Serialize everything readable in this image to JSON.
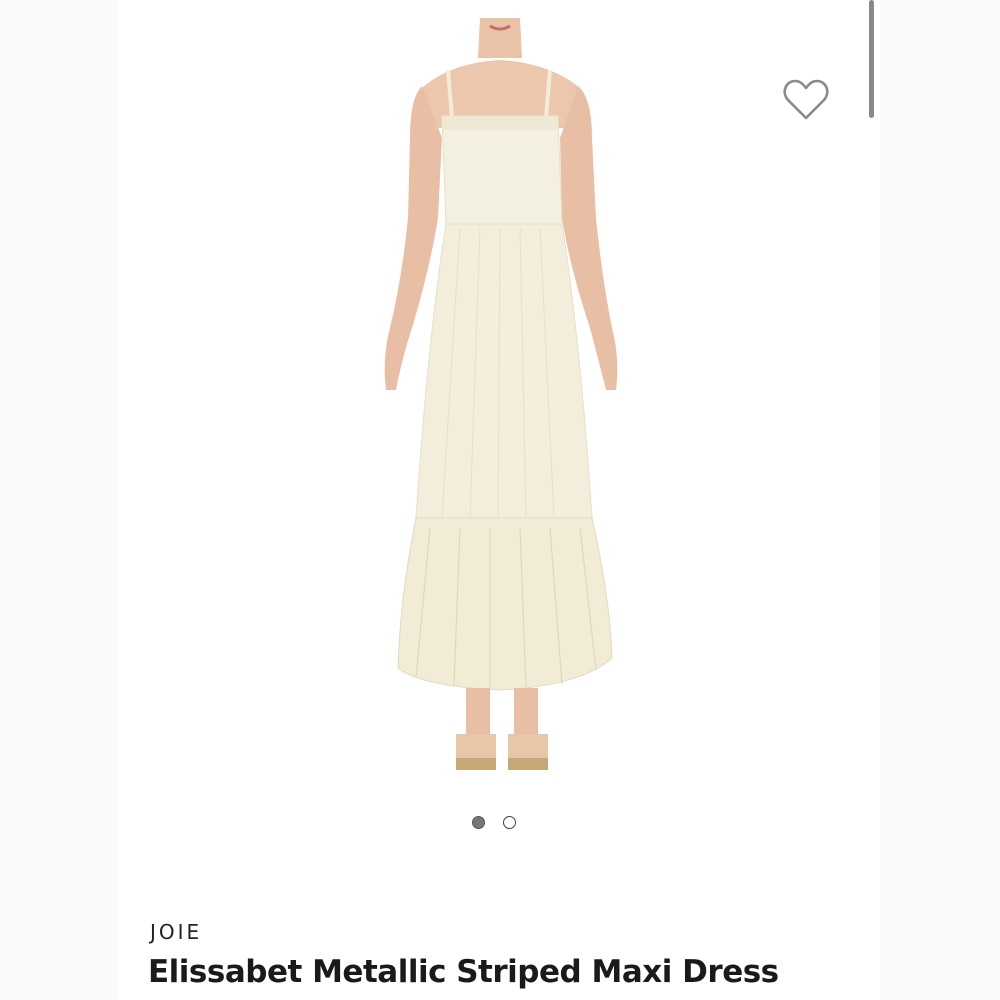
{
  "product": {
    "brand": "JOIE",
    "title": "Elissabet Metallic Striped Maxi Dress",
    "image_alt": "model wearing cream maxi dress"
  },
  "gallery": {
    "total": 2,
    "active_index": 0
  },
  "icons": {
    "wishlist": "heart-outline-icon"
  },
  "colors": {
    "dress": "#f3eedb",
    "heart": "#8a8a8a",
    "active_dot": "#777777"
  }
}
